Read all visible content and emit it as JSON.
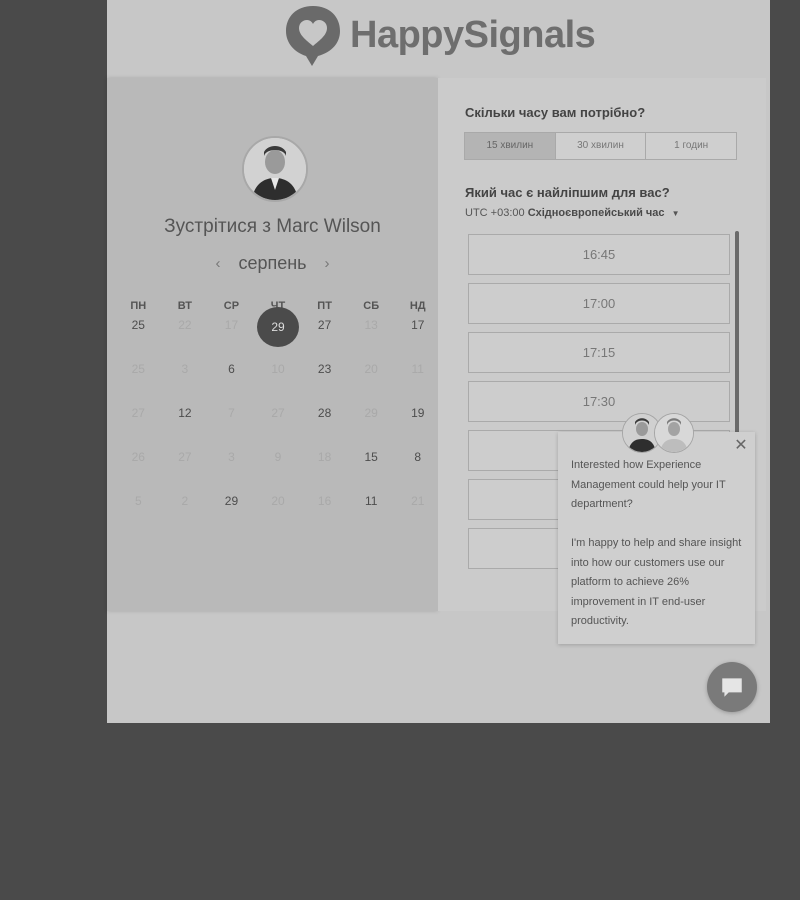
{
  "brand": {
    "name": "HappySignals"
  },
  "host": {
    "title": "Зустрітися з Marc Wilson"
  },
  "calendar": {
    "month": "серпень",
    "weekdays": [
      "ПН",
      "ВТ",
      "СР",
      "ЧТ",
      "ПТ",
      "СБ",
      "НД"
    ],
    "weeks": [
      [
        "25",
        "22",
        "17",
        "29",
        "27",
        "13",
        "17"
      ],
      [
        "25",
        "3",
        "6",
        "10",
        "23",
        "20",
        "11"
      ],
      [
        "27",
        "12",
        "7",
        "27",
        "28",
        "29",
        "19"
      ],
      [
        "26",
        "27",
        "3",
        "9",
        "18",
        "15",
        "8"
      ],
      [
        "5",
        "2",
        "29",
        "20",
        "16",
        "11",
        "21"
      ]
    ],
    "selected": "29"
  },
  "booking": {
    "duration_question": "Скільки часу вам потрібно?",
    "durations": [
      "15 хвилин",
      "30 хвилин",
      "1 годин"
    ],
    "time_question": "Який час є найліпшим для вас?",
    "timezone_offset": "UTC +03:00",
    "timezone_name": "Східноєвропейський час",
    "slots": [
      "16:45",
      "17:00",
      "17:15",
      "17:30",
      "",
      "",
      "",
      ""
    ]
  },
  "chat_popup": {
    "paragraph1": "Interested how Experience Management could help your IT department?",
    "paragraph2": "I'm happy to help and share insight into how our customers use our platform to achieve 26% improvement in IT end-user productivity."
  },
  "icons": {
    "logo": "heart-speech-bubble-icon",
    "close": "close-icon",
    "chat": "chat-bubble-icon",
    "prev": "chevron-left-icon",
    "next": "chevron-right-icon"
  }
}
